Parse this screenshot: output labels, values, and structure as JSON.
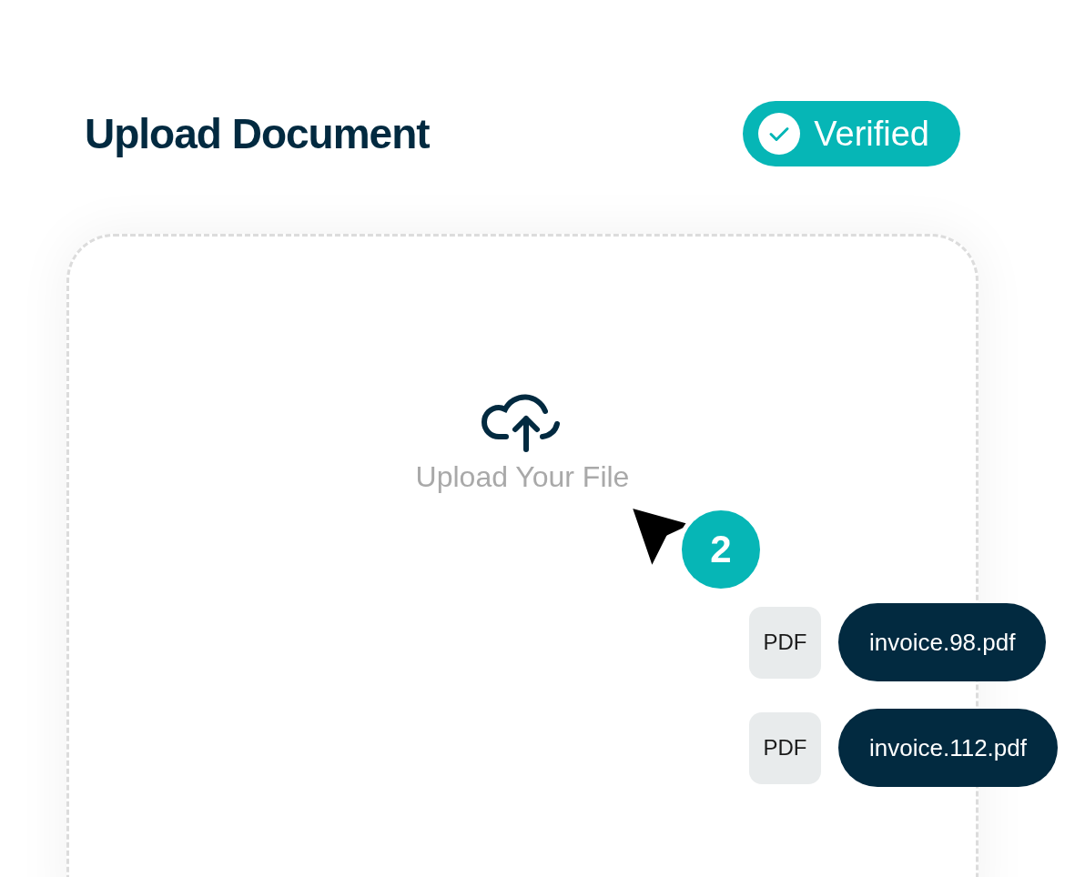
{
  "header": {
    "title": "Upload Document",
    "badge": {
      "label": "Verified",
      "verified": true
    }
  },
  "dropzone": {
    "label": "Upload Your File",
    "cursor_badge": "2"
  },
  "files": [
    {
      "type": "PDF",
      "name": "invoice.98.pdf"
    },
    {
      "type": "PDF",
      "name": "invoice.112.pdf"
    }
  ]
}
